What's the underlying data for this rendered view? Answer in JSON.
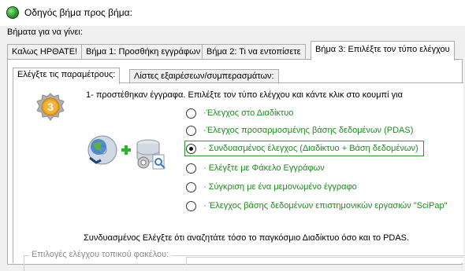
{
  "window": {
    "title": "Οδηγός βήμα προς βήμα:"
  },
  "steps_label": "Βήματα για να γίνει:",
  "tabs": [
    {
      "label": "Καλως ΗΡΘΑΤΕ!"
    },
    {
      "label": "Βήμα 1: Προσθήκη εγγράφων"
    },
    {
      "label": "Βήμα 2: Τι να εντοπίσετε"
    },
    {
      "label": "Βήμα 3: Επιλέξτε τον τύπο ελέγχου"
    }
  ],
  "inner_tabs": [
    {
      "label": "Ελέγξτε τις παραμέτρους:"
    },
    {
      "label": "Λίστες εξαιρέσεων/συμπερασμάτων:"
    }
  ],
  "step_badge": "3",
  "intro": "1- προστέθηκαν έγγραφα. Επιλέξτε τον τύπο ελέγχου και κάντε κλικ στο κουμπί για",
  "options": [
    {
      "label": "·Έλεγχος στο Διαδίκτυο",
      "checked": false
    },
    {
      "label": "·Έλεγχος προσαρμοσμένης βάσης δεδομένων (PDAS)",
      "checked": false
    },
    {
      "label": "· Συνδυασμένος έλεγχος (Διαδίκτυο + Βάση δεδομένων)",
      "checked": true
    },
    {
      "label": "· Ελέγξτε με Φάκελο Εγγράφων",
      "checked": false
    },
    {
      "label": "· Σύγκριση με ένα μεμονωμένο έγγραφο",
      "checked": false
    },
    {
      "label": "· Έλεγχος βάσης δεδομένων επιστημονικών εργασιών \"SciPap\"",
      "checked": false
    }
  ],
  "description": "Συνδυασμένος Ελέγξτε ότι αναζητάτε τόσο το παγκόσμιο Διαδίκτυο όσο και το PDAS.",
  "local_folder_group": "Επιλογές ελέγχου τοπικού φακέλου:",
  "colors": {
    "option_text": "#1f8a1f",
    "badge": "#e9a020",
    "selection_border": "#2e9b2e"
  },
  "icons": {
    "app": "green-globe-icon",
    "badge": "step-three-badge-icon",
    "web": "globe-cd-icon",
    "plus": "plus-icon",
    "database": "database-icon"
  }
}
